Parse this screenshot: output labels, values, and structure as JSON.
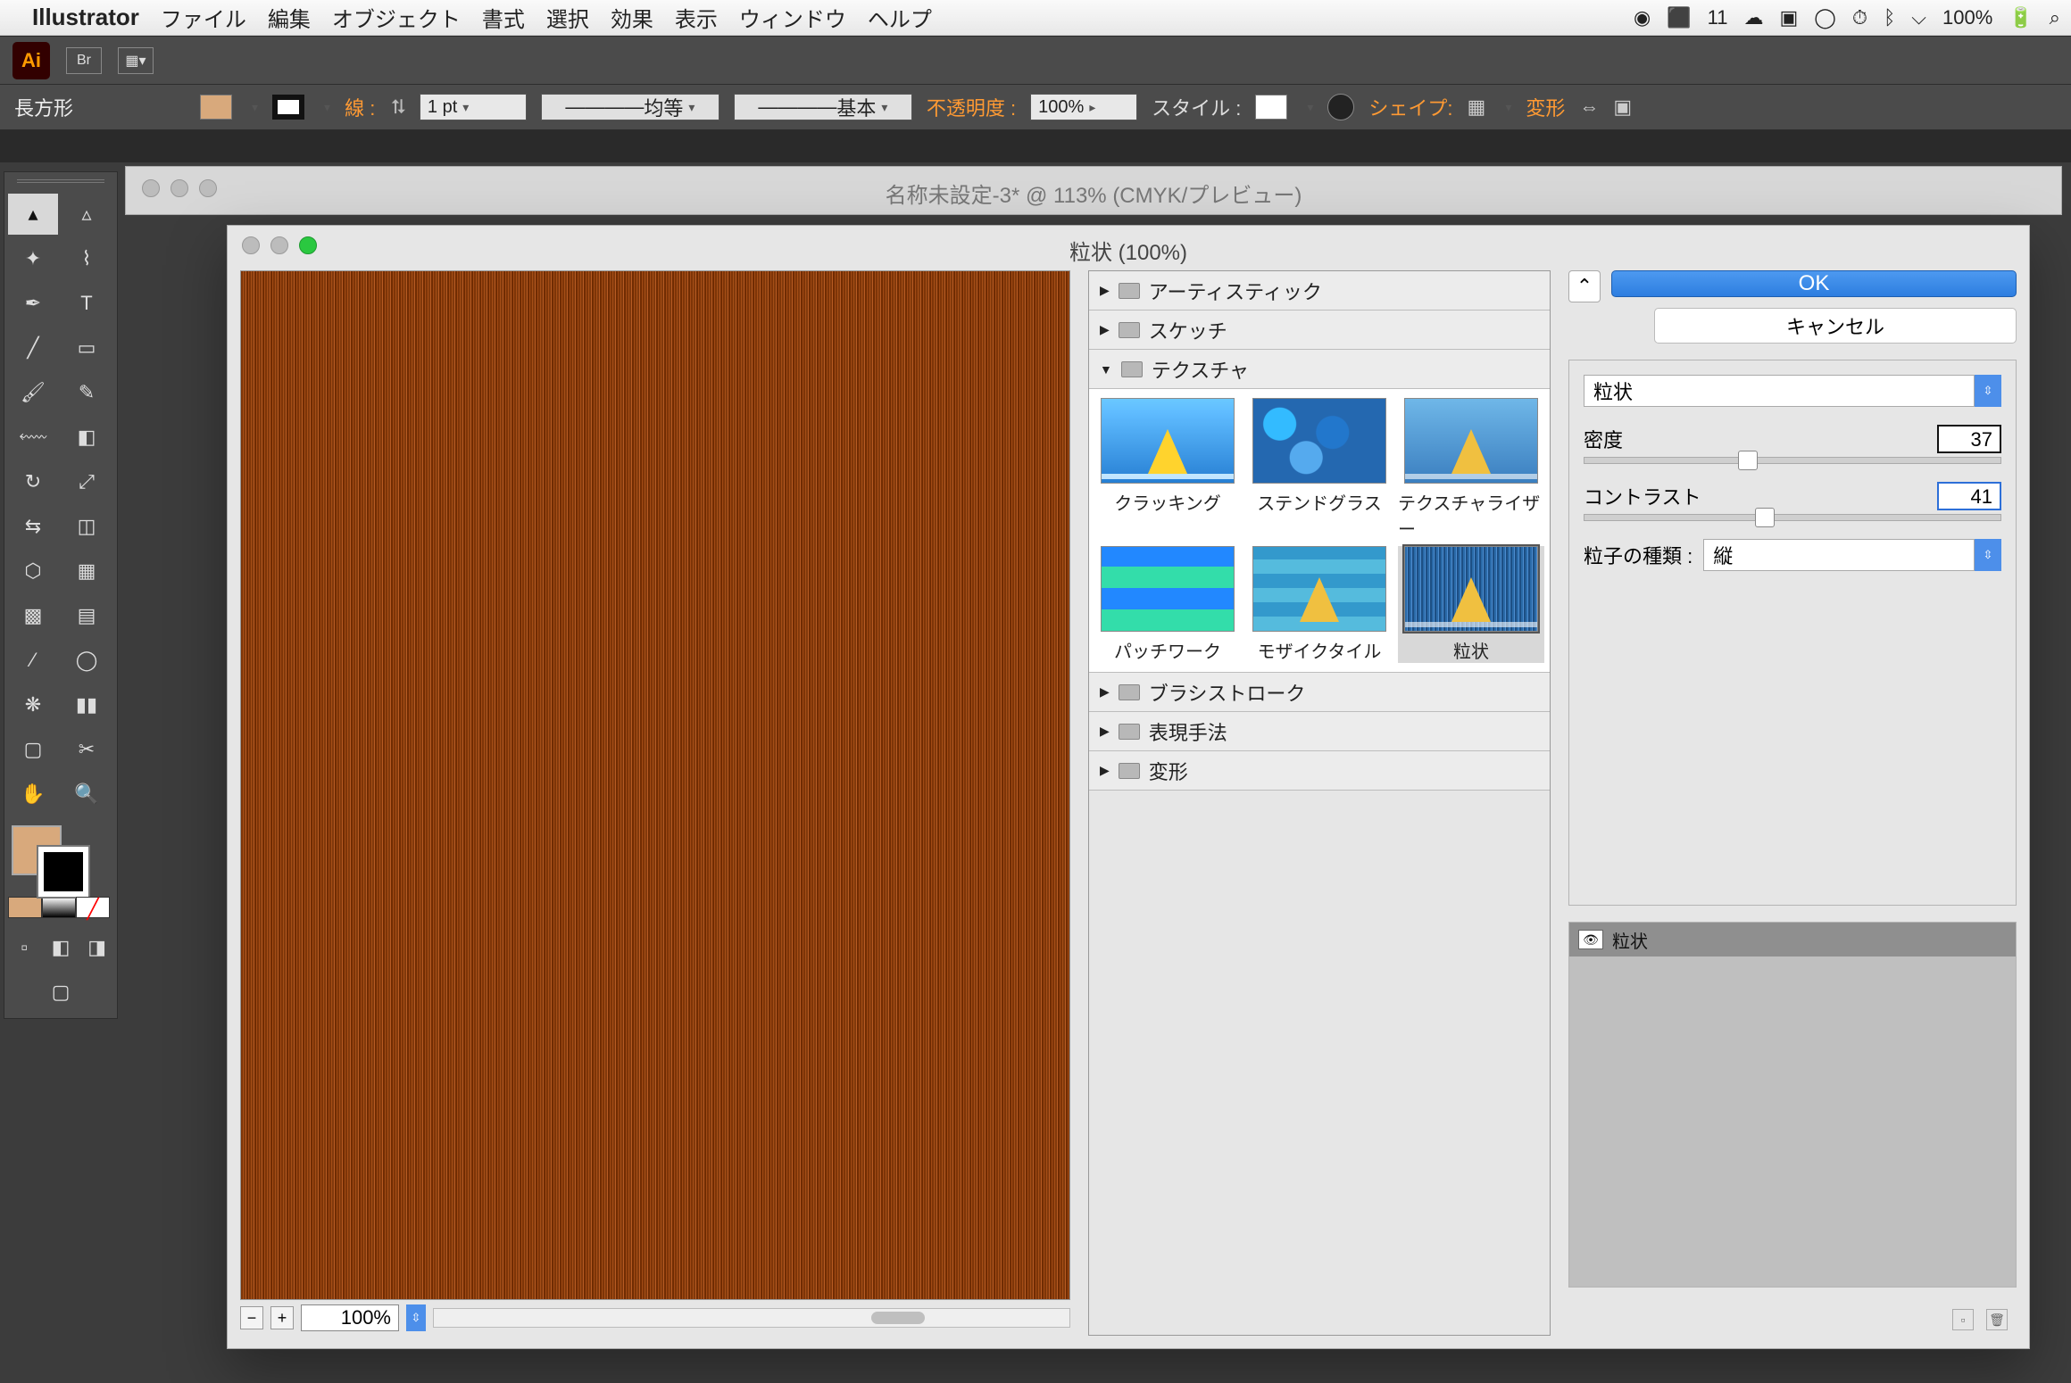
{
  "menubar": {
    "app": "Illustrator",
    "items": [
      "ファイル",
      "編集",
      "オブジェクト",
      "書式",
      "選択",
      "効果",
      "表示",
      "ウィンドウ",
      "ヘルプ"
    ],
    "status_count": "11",
    "battery": "100%"
  },
  "controlbar": {
    "tool_label": "長方形",
    "stroke_label": "線 :",
    "stroke_weight": "1 pt",
    "stroke_uniform": "均等",
    "stroke_basic": "基本",
    "opacity_label": "不透明度 :",
    "opacity_value": "100%",
    "style_label": "スタイル :",
    "shape_label": "シェイプ:",
    "transform_label": "変形"
  },
  "doc": {
    "title": "名称未設定-3* @ 113% (CMYK/プレビュー)"
  },
  "modal": {
    "title": "粒状 (100%)",
    "ok": "OK",
    "cancel": "キャンセル",
    "zoom": "100%",
    "tree": {
      "artistic": "アーティスティック",
      "sketch": "スケッチ",
      "texture": "テクスチャ",
      "brush": "ブラシストローク",
      "express": "表現手法",
      "distort": "変形"
    },
    "thumbs": {
      "craquelure": "クラッキング",
      "stained": "ステンドグラス",
      "texturizer": "テクスチャライザー",
      "patchwork": "パッチワーク",
      "mosaic": "モザイクタイル",
      "grain": "粒状"
    },
    "params": {
      "filter_name": "粒状",
      "density_label": "密度",
      "density_value": "37",
      "contrast_label": "コントラスト",
      "contrast_value": "41",
      "type_label": "粒子の種類 :",
      "type_value": "縦"
    },
    "layer": {
      "name": "粒状"
    }
  }
}
